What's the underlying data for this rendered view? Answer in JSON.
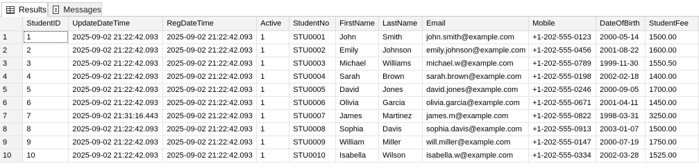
{
  "tabs": [
    {
      "label": "Results",
      "icon": "grid-icon",
      "active": true
    },
    {
      "label": "Messages",
      "icon": "messages-icon",
      "active": false
    }
  ],
  "grid": {
    "columns": [
      "StudentID",
      "UpdateDateTime",
      "RegDateTime",
      "Active",
      "StudentNo",
      "FirstName",
      "LastName",
      "Email",
      "Mobile",
      "DateOfBirth",
      "StudentFee"
    ],
    "selected_cell": {
      "row": 0,
      "column": "StudentID"
    },
    "rows": [
      {
        "num": "1",
        "cells": [
          "1",
          "2025-09-02 21:22:42.093",
          "2025-09-02 21:22:42.093",
          "1",
          "STU0001",
          "John",
          "Smith",
          "john.smith@example.com",
          "+1-202-555-0123",
          "2000-05-14",
          "1500.00"
        ]
      },
      {
        "num": "2",
        "cells": [
          "2",
          "2025-09-02 21:22:42.093",
          "2025-09-02 21:22:42.093",
          "1",
          "STU0002",
          "Emily",
          "Johnson",
          "emily.johnson@example.com",
          "+1-202-555-0456",
          "2001-08-22",
          "1600.00"
        ]
      },
      {
        "num": "3",
        "cells": [
          "3",
          "2025-09-02 21:22:42.093",
          "2025-09-02 21:22:42.093",
          "1",
          "STU0003",
          "Michael",
          "Williams",
          "michael.w@example.com",
          "+1-202-555-0789",
          "1999-11-30",
          "1550.50"
        ]
      },
      {
        "num": "4",
        "cells": [
          "4",
          "2025-09-02 21:22:42.093",
          "2025-09-02 21:22:42.093",
          "1",
          "STU0004",
          "Sarah",
          "Brown",
          "sarah.brown@example.com",
          "+1-202-555-0198",
          "2002-02-18",
          "1400.00"
        ]
      },
      {
        "num": "5",
        "cells": [
          "5",
          "2025-09-02 21:22:42.093",
          "2025-09-02 21:22:42.093",
          "1",
          "STU0005",
          "David",
          "Jones",
          "david.jones@example.com",
          "+1-202-555-0246",
          "2000-09-05",
          "1700.00"
        ]
      },
      {
        "num": "6",
        "cells": [
          "6",
          "2025-09-02 21:22:42.093",
          "2025-09-02 21:22:42.093",
          "1",
          "STU0006",
          "Olivia",
          "Garcia",
          "olivia.garcia@example.com",
          "+1-202-555-0671",
          "2001-04-11",
          "1450.00"
        ]
      },
      {
        "num": "7",
        "cells": [
          "7",
          "2025-09-02 21:31:16.443",
          "2025-09-02 21:22:42.093",
          "1",
          "STU0007",
          "James",
          "Martinez",
          "james.m@example.com",
          "+1-202-555-0822",
          "1998-03-31",
          "3250.00"
        ]
      },
      {
        "num": "8",
        "cells": [
          "8",
          "2025-09-02 21:22:42.093",
          "2025-09-02 21:22:42.093",
          "1",
          "STU0008",
          "Sophia",
          "Davis",
          "sophia.davis@example.com",
          "+1-202-555-0913",
          "2003-01-07",
          "1500.00"
        ]
      },
      {
        "num": "9",
        "cells": [
          "9",
          "2025-09-02 21:22:42.093",
          "2025-09-02 21:22:42.093",
          "1",
          "STU0009",
          "William",
          "Miller",
          "will.miller@example.com",
          "+1-202-555-0147",
          "2000-07-19",
          "1750.00"
        ]
      },
      {
        "num": "10",
        "cells": [
          "10",
          "2025-09-02 21:22:42.093",
          "2025-09-02 21:22:42.093",
          "1",
          "STU0010",
          "Isabella",
          "Wilson",
          "isabella.w@example.com",
          "+1-202-555-0334",
          "2002-03-28",
          "1525.00"
        ]
      }
    ]
  }
}
